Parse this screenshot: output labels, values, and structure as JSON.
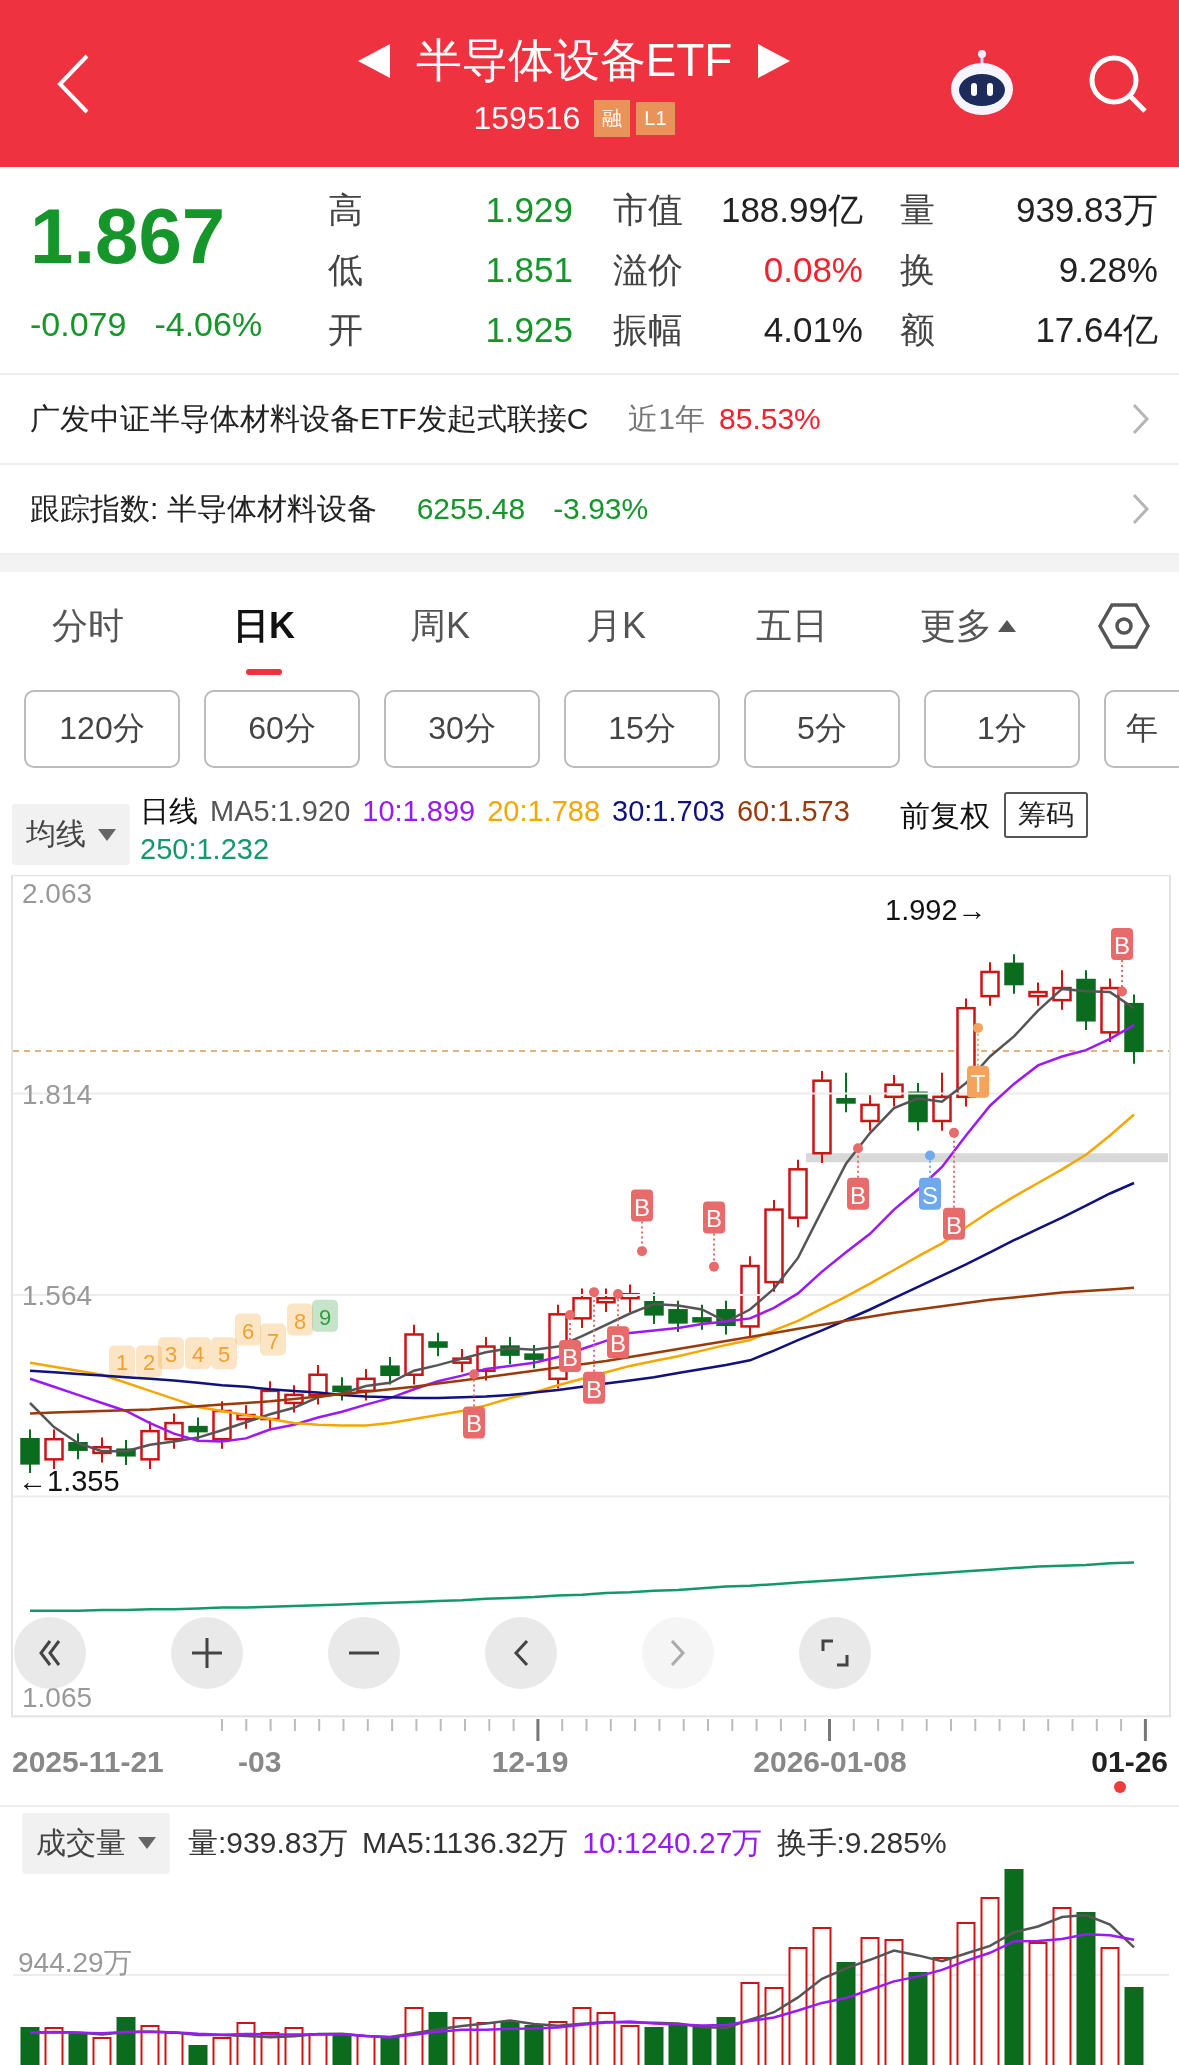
{
  "header": {
    "title": "半导体设备ETF",
    "code": "159516",
    "tags": [
      "融",
      "L1"
    ]
  },
  "quote": {
    "price": "1.867",
    "change": "-0.079",
    "change_pct": "-4.06%",
    "stats": [
      {
        "label": "高",
        "value": "1.929",
        "color": "#15952a"
      },
      {
        "label": "市值",
        "value": "188.99亿",
        "color": "#222222"
      },
      {
        "label": "量",
        "value": "939.83万",
        "color": "#222222"
      },
      {
        "label": "低",
        "value": "1.851",
        "color": "#15952a"
      },
      {
        "label": "溢价",
        "value": "0.08%",
        "color": "#f0222e"
      },
      {
        "label": "换",
        "value": "9.28%",
        "color": "#222222"
      },
      {
        "label": "开",
        "value": "1.925",
        "color": "#15952a"
      },
      {
        "label": "振幅",
        "value": "4.01%",
        "color": "#222222"
      },
      {
        "label": "额",
        "value": "17.64亿",
        "color": "#222222"
      }
    ]
  },
  "fund_link": {
    "name": "广发中证半导体材料设备ETF发起式联接C",
    "period": "近1年",
    "return": "85.53%"
  },
  "index_link": {
    "label": "跟踪指数: 半导体材料设备",
    "value": "6255.48",
    "change": "-3.93%"
  },
  "tabs": [
    {
      "label": "分时",
      "selected": false,
      "kind": "view"
    },
    {
      "label": "日K",
      "selected": true,
      "kind": "view"
    },
    {
      "label": "周K",
      "selected": false,
      "kind": "view"
    },
    {
      "label": "月K",
      "selected": false,
      "kind": "view"
    },
    {
      "label": "五日",
      "selected": false,
      "kind": "view"
    },
    {
      "label": "更多",
      "selected": false,
      "kind": "menu"
    }
  ],
  "period_buttons": [
    "120分",
    "60分",
    "30分",
    "15分",
    "5分",
    "1分",
    "年"
  ],
  "indicator": {
    "selector": "均线",
    "line_type": "日线",
    "adjust": "前复权",
    "chips": "筹码"
  },
  "kline": {
    "high_marker": "1.992→",
    "low_marker": "←1.355",
    "chart_data": {
      "type": "line",
      "ylim": [
        1.041,
        2.085
      ],
      "yticks": [
        {
          "value": 2.063,
          "label": "2.063"
        },
        {
          "value": 1.814,
          "label": "1.814"
        },
        {
          "value": 1.564,
          "label": "1.564"
        },
        {
          "value": 1.065,
          "label": "1.065"
        }
      ],
      "series": [
        {
          "name": "MA5:1.920",
          "color": "#555555",
          "values": [
            1.43,
            1.4,
            1.38,
            1.37,
            1.37,
            1.378,
            1.382,
            1.387,
            1.396,
            1.406,
            1.416,
            1.424,
            1.437,
            1.442,
            1.451,
            1.455,
            1.47,
            1.477,
            1.485,
            1.493,
            1.498,
            1.496,
            1.5,
            1.513,
            1.527,
            1.541,
            1.553,
            1.551,
            1.546,
            1.531,
            1.546,
            1.572,
            1.61,
            1.669,
            1.727,
            1.765,
            1.796,
            1.808,
            1.804,
            1.827,
            1.86,
            1.885,
            1.917,
            1.944,
            1.941,
            1.94,
            1.92
          ]
        },
        {
          "name": "10:1.899",
          "color": "#9b19f5",
          "values": [
            1.46,
            1.45,
            1.44,
            1.43,
            1.42,
            1.405,
            1.392,
            1.383,
            1.382,
            1.386,
            1.397,
            1.403,
            1.412,
            1.419,
            1.428,
            1.436,
            1.447,
            1.457,
            1.464,
            1.472,
            1.476,
            1.48,
            1.487,
            1.497,
            1.507,
            1.517,
            1.52,
            1.523,
            1.528,
            1.531,
            1.535,
            1.548,
            1.566,
            1.593,
            1.617,
            1.64,
            1.67,
            1.695,
            1.723,
            1.762,
            1.799,
            1.826,
            1.849,
            1.86,
            1.868,
            1.882,
            1.899
          ]
        },
        {
          "name": "20:1.788",
          "color": "#f5a700",
          "values": [
            1.48,
            1.475,
            1.47,
            1.465,
            1.455,
            1.445,
            1.435,
            1.425,
            1.42,
            1.415,
            1.41,
            1.405,
            1.403,
            1.402,
            1.402,
            1.405,
            1.41,
            1.415,
            1.42,
            1.427,
            1.436,
            1.443,
            1.452,
            1.46,
            1.468,
            1.476,
            1.482,
            1.488,
            1.495,
            1.502,
            1.508,
            1.52,
            1.532,
            1.547,
            1.562,
            1.578,
            1.595,
            1.612,
            1.628,
            1.648,
            1.668,
            1.686,
            1.703,
            1.72,
            1.738,
            1.762,
            1.788
          ]
        },
        {
          "name": "30:1.703",
          "color": "#10107f",
          "values": [
            1.47,
            1.468,
            1.466,
            1.464,
            1.462,
            1.46,
            1.458,
            1.455,
            1.452,
            1.45,
            1.447,
            1.445,
            1.443,
            1.44,
            1.438,
            1.437,
            1.436,
            1.436,
            1.437,
            1.438,
            1.44,
            1.443,
            1.446,
            1.45,
            1.454,
            1.458,
            1.462,
            1.467,
            1.472,
            1.477,
            1.483,
            1.495,
            1.508,
            1.52,
            1.533,
            1.546,
            1.56,
            1.574,
            1.588,
            1.602,
            1.617,
            1.632,
            1.646,
            1.66,
            1.675,
            1.69,
            1.703
          ]
        },
        {
          "name": "60:1.573",
          "color": "#9a3a0a",
          "values": [
            1.417,
            1.418,
            1.419,
            1.42,
            1.421,
            1.422,
            1.424,
            1.426,
            1.428,
            1.43,
            1.432,
            1.435,
            1.438,
            1.441,
            1.444,
            1.447,
            1.45,
            1.454,
            1.458,
            1.462,
            1.466,
            1.47,
            1.474,
            1.478,
            1.482,
            1.487,
            1.492,
            1.497,
            1.502,
            1.507,
            1.512,
            1.517,
            1.522,
            1.527,
            1.532,
            1.537,
            1.542,
            1.546,
            1.55,
            1.554,
            1.558,
            1.561,
            1.564,
            1.567,
            1.569,
            1.571,
            1.573
          ]
        },
        {
          "name": "250:1.232",
          "color": "#13986a",
          "values": [
            1.172,
            1.172,
            1.172,
            1.173,
            1.173,
            1.174,
            1.174,
            1.175,
            1.176,
            1.176,
            1.177,
            1.178,
            1.179,
            1.18,
            1.181,
            1.182,
            1.183,
            1.184,
            1.185,
            1.187,
            1.188,
            1.189,
            1.191,
            1.192,
            1.194,
            1.195,
            1.197,
            1.198,
            1.2,
            1.202,
            1.203,
            1.205,
            1.207,
            1.209,
            1.211,
            1.213,
            1.215,
            1.217,
            1.219,
            1.221,
            1.223,
            1.225,
            1.227,
            1.228,
            1.229,
            1.231,
            1.232
          ]
        }
      ]
    },
    "signals": [
      {
        "label": "B",
        "kind": "buy"
      },
      {
        "label": "B",
        "kind": "buy"
      },
      {
        "label": "B",
        "kind": "buy"
      },
      {
        "label": "B",
        "kind": "buy"
      },
      {
        "label": "B",
        "kind": "buy"
      },
      {
        "label": "B",
        "kind": "buy"
      },
      {
        "label": "B",
        "kind": "buy"
      },
      {
        "label": "S",
        "kind": "sell"
      },
      {
        "label": "B",
        "kind": "buy"
      },
      {
        "label": "T",
        "kind": "t"
      },
      {
        "label": "B",
        "kind": "buy"
      }
    ],
    "td_counts": [
      {
        "label": "1",
        "color": "#f0a030"
      },
      {
        "label": "2",
        "color": "#f0a030"
      },
      {
        "label": "3",
        "color": "#f0a030"
      },
      {
        "label": "4",
        "color": "#f0a030"
      },
      {
        "label": "5",
        "color": "#f0a030"
      },
      {
        "label": "6",
        "color": "#f0a030"
      },
      {
        "label": "7",
        "color": "#f0a030"
      },
      {
        "label": "8",
        "color": "#f0a030"
      },
      {
        "label": "9",
        "color": "#2f9d3c"
      }
    ]
  },
  "chart_controls": [
    {
      "kind": "rewind",
      "disabled": false
    },
    {
      "kind": "zoom_in",
      "disabled": false
    },
    {
      "kind": "zoom_out",
      "disabled": false
    },
    {
      "kind": "prev",
      "disabled": false
    },
    {
      "kind": "next",
      "disabled": true
    },
    {
      "kind": "fullscreen",
      "disabled": false
    }
  ],
  "x_axis": [
    {
      "label": "2025-11-21",
      "current": false
    },
    {
      "label": "-03",
      "current": false
    },
    {
      "label": "12-19",
      "current": false
    },
    {
      "label": "2026-01-08",
      "current": false
    },
    {
      "label": "01-26",
      "current": true
    }
  ],
  "volume": {
    "selector": "成交量",
    "stats": [
      {
        "label": "量:939.83万",
        "color": "#333333"
      },
      {
        "label": "MA5:1136.32万",
        "color": "#333333"
      },
      {
        "label": "10:1240.27万",
        "color": "#9b19f5"
      },
      {
        "label": "换手:9.285%",
        "color": "#333333"
      }
    ],
    "y_label": "944.29万"
  }
}
